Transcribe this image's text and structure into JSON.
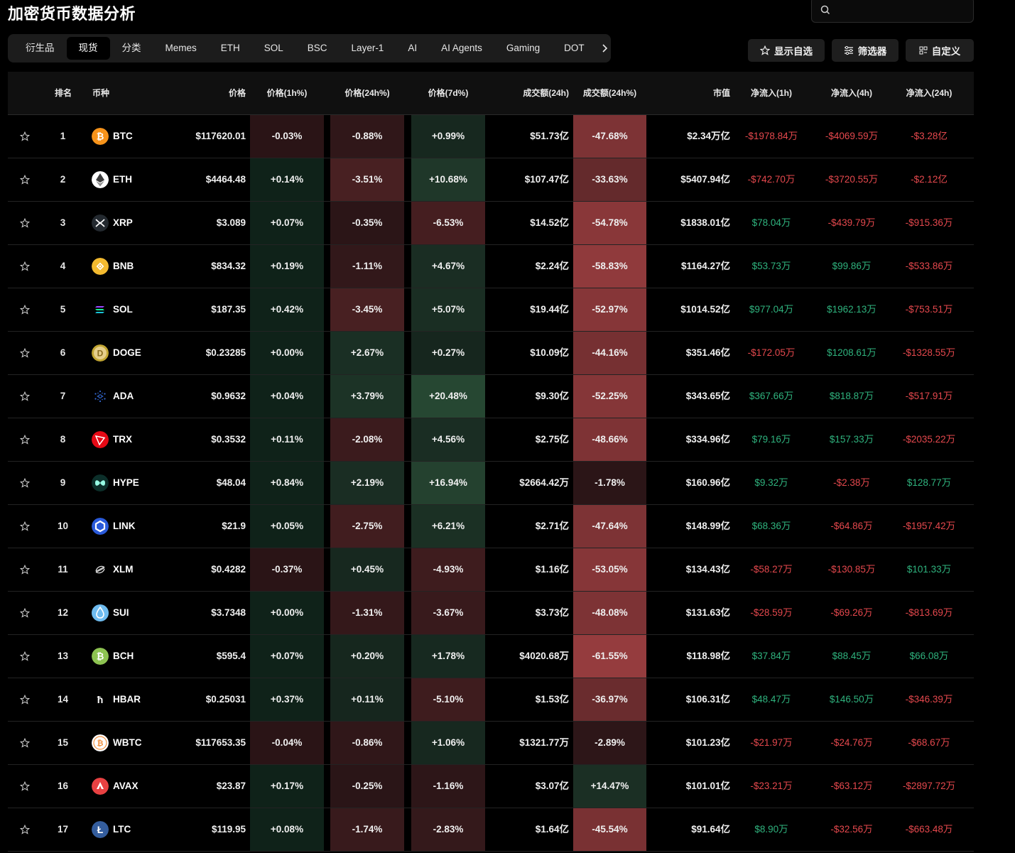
{
  "header": {
    "title": "加密货币数据分析",
    "search_placeholder": ""
  },
  "tabs": [
    {
      "label": "衍生品",
      "active": false
    },
    {
      "label": "现货",
      "active": true
    },
    {
      "label": "分类",
      "active": false
    },
    {
      "label": "Memes",
      "active": false
    },
    {
      "label": "ETH",
      "active": false
    },
    {
      "label": "SOL",
      "active": false
    },
    {
      "label": "BSC",
      "active": false
    },
    {
      "label": "Layer-1",
      "active": false
    },
    {
      "label": "AI",
      "active": false
    },
    {
      "label": "AI Agents",
      "active": false
    },
    {
      "label": "Gaming",
      "active": false
    },
    {
      "label": "DOT",
      "active": false
    }
  ],
  "actions": {
    "watchlist": "显示自选",
    "filter": "筛选器",
    "customize": "自定义"
  },
  "columns": {
    "rank": "排名",
    "coin": "币种",
    "price": "价格",
    "chg1h": "价格(1h%)",
    "chg24h": "价格(24h%)",
    "chg7d": "价格(7d%)",
    "vol24h": "成交额(24h)",
    "vol24h_chg": "成交额(24h%)",
    "mcap": "市值",
    "flow1h": "净流入(1h)",
    "flow4h": "净流入(4h)",
    "flow24h": "净流入(24h)"
  },
  "colors": {
    "positive": "#2fb37e",
    "negative": "#e5484d",
    "background": "#000000"
  },
  "rows": [
    {
      "rank": "1",
      "coin": "BTC",
      "icon": "btc-icon",
      "iconColor": "#f7931a",
      "price": "$117620.01",
      "chg1h": "-0.03%",
      "chg24h": "-0.88%",
      "chg7d": "+0.99%",
      "vol": "$51.73亿",
      "volchg": "-47.68%",
      "mcap": "$2.34万亿",
      "f1": "-$1978.84万",
      "f4": "-$4069.59万",
      "f24": "-$3.28亿"
    },
    {
      "rank": "2",
      "coin": "ETH",
      "icon": "eth-icon",
      "iconColor": "#ffffff",
      "price": "$4464.48",
      "chg1h": "+0.14%",
      "chg24h": "-3.51%",
      "chg7d": "+10.68%",
      "vol": "$107.47亿",
      "volchg": "-33.63%",
      "mcap": "$5407.94亿",
      "f1": "-$742.70万",
      "f4": "-$3720.55万",
      "f24": "-$2.12亿"
    },
    {
      "rank": "3",
      "coin": "XRP",
      "icon": "xrp-icon",
      "iconColor": "#23292f",
      "price": "$3.089",
      "chg1h": "+0.07%",
      "chg24h": "-0.35%",
      "chg7d": "-6.53%",
      "vol": "$14.52亿",
      "volchg": "-54.78%",
      "mcap": "$1838.01亿",
      "f1": "$78.04万",
      "f4": "-$439.79万",
      "f24": "-$915.36万"
    },
    {
      "rank": "4",
      "coin": "BNB",
      "icon": "bnb-icon",
      "iconColor": "#f3ba2f",
      "price": "$834.32",
      "chg1h": "+0.19%",
      "chg24h": "-1.11%",
      "chg7d": "+4.67%",
      "vol": "$2.24亿",
      "volchg": "-58.83%",
      "mcap": "$1164.27亿",
      "f1": "$53.73万",
      "f4": "$99.86万",
      "f24": "-$533.86万"
    },
    {
      "rank": "5",
      "coin": "SOL",
      "icon": "sol-icon",
      "iconColor": "#9945ff",
      "price": "$187.35",
      "chg1h": "+0.42%",
      "chg24h": "-3.45%",
      "chg7d": "+5.07%",
      "vol": "$19.44亿",
      "volchg": "-52.97%",
      "mcap": "$1014.52亿",
      "f1": "$977.04万",
      "f4": "$1962.13万",
      "f24": "-$753.51万"
    },
    {
      "rank": "6",
      "coin": "DOGE",
      "icon": "doge-icon",
      "iconColor": "#c2a633",
      "price": "$0.23285",
      "chg1h": "+0.00%",
      "chg24h": "+2.67%",
      "chg7d": "+0.27%",
      "vol": "$10.09亿",
      "volchg": "-44.16%",
      "mcap": "$351.46亿",
      "f1": "-$172.05万",
      "f4": "$1208.61万",
      "f24": "-$1328.55万"
    },
    {
      "rank": "7",
      "coin": "ADA",
      "icon": "ada-icon",
      "iconColor": "#0033ad",
      "price": "$0.9632",
      "chg1h": "+0.04%",
      "chg24h": "+3.79%",
      "chg7d": "+20.48%",
      "vol": "$9.30亿",
      "volchg": "-52.25%",
      "mcap": "$343.65亿",
      "f1": "$367.66万",
      "f4": "$818.87万",
      "f24": "-$517.91万"
    },
    {
      "rank": "8",
      "coin": "TRX",
      "icon": "trx-icon",
      "iconColor": "#e50915",
      "price": "$0.3532",
      "chg1h": "+0.11%",
      "chg24h": "-2.08%",
      "chg7d": "+4.56%",
      "vol": "$2.75亿",
      "volchg": "-48.66%",
      "mcap": "$334.96亿",
      "f1": "$79.16万",
      "f4": "$157.33万",
      "f24": "-$2035.22万"
    },
    {
      "rank": "9",
      "coin": "HYPE",
      "icon": "hype-icon",
      "iconColor": "#0f3b33",
      "price": "$48.04",
      "chg1h": "+0.84%",
      "chg24h": "+2.19%",
      "chg7d": "+16.94%",
      "vol": "$2664.42万",
      "volchg": "-1.78%",
      "mcap": "$160.96亿",
      "f1": "$9.32万",
      "f4": "-$2.38万",
      "f24": "$128.77万"
    },
    {
      "rank": "10",
      "coin": "LINK",
      "icon": "link-icon",
      "iconColor": "#2a5ada",
      "price": "$21.9",
      "chg1h": "+0.05%",
      "chg24h": "-2.75%",
      "chg7d": "+6.21%",
      "vol": "$2.71亿",
      "volchg": "-47.64%",
      "mcap": "$148.99亿",
      "f1": "$68.36万",
      "f4": "-$64.86万",
      "f24": "-$1957.42万"
    },
    {
      "rank": "11",
      "coin": "XLM",
      "icon": "xlm-icon",
      "iconColor": "#000000",
      "price": "$0.4282",
      "chg1h": "-0.37%",
      "chg24h": "+0.45%",
      "chg7d": "-4.93%",
      "vol": "$1.16亿",
      "volchg": "-53.05%",
      "mcap": "$134.43亿",
      "f1": "-$58.27万",
      "f4": "-$130.85万",
      "f24": "$101.33万"
    },
    {
      "rank": "12",
      "coin": "SUI",
      "icon": "sui-icon",
      "iconColor": "#6fbcf0",
      "price": "$3.7348",
      "chg1h": "+0.00%",
      "chg24h": "-1.31%",
      "chg7d": "-3.67%",
      "vol": "$3.73亿",
      "volchg": "-48.08%",
      "mcap": "$131.63亿",
      "f1": "-$28.59万",
      "f4": "-$69.26万",
      "f24": "-$813.69万"
    },
    {
      "rank": "13",
      "coin": "BCH",
      "icon": "bch-icon",
      "iconColor": "#8dc351",
      "price": "$595.4",
      "chg1h": "+0.07%",
      "chg24h": "+0.20%",
      "chg7d": "+1.78%",
      "vol": "$4020.68万",
      "volchg": "-61.55%",
      "mcap": "$118.98亿",
      "f1": "$37.84万",
      "f4": "$88.45万",
      "f24": "$66.08万"
    },
    {
      "rank": "14",
      "coin": "HBAR",
      "icon": "hbar-icon",
      "iconColor": "#000000",
      "price": "$0.25031",
      "chg1h": "+0.37%",
      "chg24h": "+0.11%",
      "chg7d": "-5.10%",
      "vol": "$1.53亿",
      "volchg": "-36.97%",
      "mcap": "$106.31亿",
      "f1": "$48.47万",
      "f4": "$146.50万",
      "f24": "-$346.39万"
    },
    {
      "rank": "15",
      "coin": "WBTC",
      "icon": "wbtc-icon",
      "iconColor": "#ffffff",
      "price": "$117653.35",
      "chg1h": "-0.04%",
      "chg24h": "-0.86%",
      "chg7d": "+1.06%",
      "vol": "$1321.77万",
      "volchg": "-2.89%",
      "mcap": "$101.23亿",
      "f1": "-$21.97万",
      "f4": "-$24.76万",
      "f24": "-$68.67万"
    },
    {
      "rank": "16",
      "coin": "AVAX",
      "icon": "avax-icon",
      "iconColor": "#e84142",
      "price": "$23.87",
      "chg1h": "+0.17%",
      "chg24h": "-0.25%",
      "chg7d": "-1.16%",
      "vol": "$3.07亿",
      "volchg": "+14.47%",
      "mcap": "$101.01亿",
      "f1": "-$23.21万",
      "f4": "-$63.12万",
      "f24": "-$2897.72万"
    },
    {
      "rank": "17",
      "coin": "LTC",
      "icon": "ltc-icon",
      "iconColor": "#345d9d",
      "price": "$119.95",
      "chg1h": "+0.08%",
      "chg24h": "-1.74%",
      "chg7d": "-2.83%",
      "vol": "$1.64亿",
      "volchg": "-45.54%",
      "mcap": "$91.64亿",
      "f1": "$8.90万",
      "f4": "-$32.56万",
      "f24": "-$663.48万"
    }
  ]
}
